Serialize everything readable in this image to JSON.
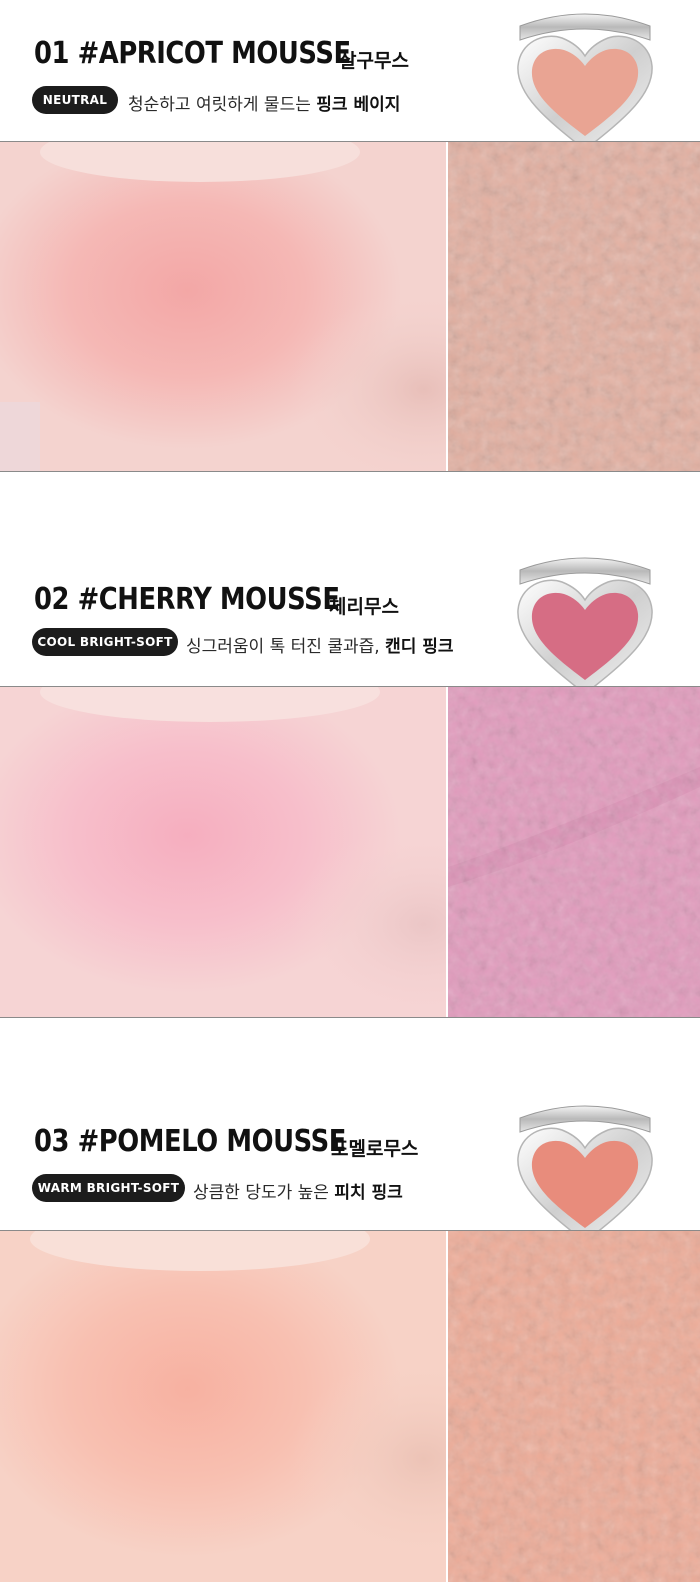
{
  "products": [
    {
      "title": "01 #APRICOT MOUSSE",
      "korean_name": "살구무스",
      "tone": "NEUTRAL",
      "desc_plain": "청순하고 여릿하게 물드는 ",
      "desc_bold": "핑크 베이지",
      "pan_color": "#e9a493",
      "skin_color": "#f4d3cf",
      "blush_color": "#f3a7a6",
      "texture_color": "#e4b0a1"
    },
    {
      "title": "02 #CHERRY MOUSSE",
      "korean_name": "체리무스",
      "tone": "COOL BRIGHT-SOFT",
      "desc_plain": "싱그러움이 톡 터진 쿨과즙, ",
      "desc_bold": "캔디 핑크",
      "pan_color": "#d66d84",
      "skin_color": "#f6d4d4",
      "blush_color": "#f6aebf",
      "texture_color": "#e29bbd"
    },
    {
      "title": "03 #POMELO MOUSSE",
      "korean_name": "포멜로무스",
      "tone": "WARM BRIGHT-SOFT",
      "desc_plain": "상큼한 당도가 높은 ",
      "desc_bold": "피치 핑크",
      "pan_color": "#e88c7c",
      "skin_color": "#f7d2c6",
      "blush_color": "#f7b1a1",
      "texture_color": "#eeac98"
    }
  ]
}
